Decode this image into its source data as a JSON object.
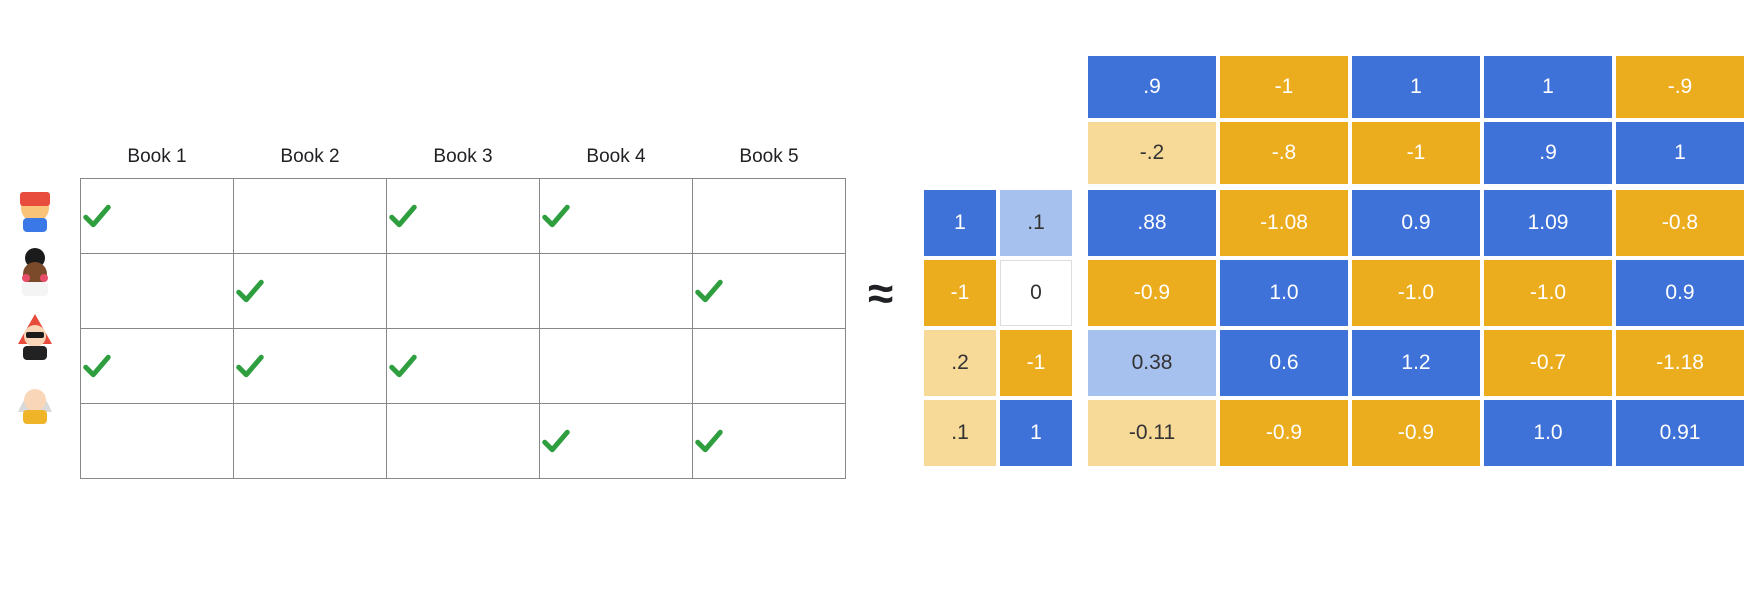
{
  "books": {
    "headers": [
      "Book 1",
      "Book 2",
      "Book 3",
      "Book 4",
      "Book 5"
    ],
    "checks": [
      [
        true,
        false,
        true,
        true,
        false
      ],
      [
        false,
        true,
        false,
        false,
        true
      ],
      [
        true,
        true,
        true,
        false,
        false
      ],
      [
        false,
        false,
        false,
        true,
        true
      ]
    ]
  },
  "approx_symbol": "≈",
  "chart_data": {
    "type": "table",
    "U": {
      "rows": 4,
      "cols": 2,
      "cells": [
        {
          "v": "1",
          "c": "blue"
        },
        {
          "v": ".1",
          "c": "blue-light"
        },
        {
          "v": "-1",
          "c": "gold"
        },
        {
          "v": "0",
          "c": "white"
        },
        {
          "v": ".2",
          "c": "gold-light"
        },
        {
          "v": "-1",
          "c": "gold"
        },
        {
          "v": ".1",
          "c": "gold-light"
        },
        {
          "v": "1",
          "c": "blue"
        }
      ]
    },
    "V": {
      "rows": 2,
      "cols": 5,
      "cells": [
        {
          "v": ".9",
          "c": "blue"
        },
        {
          "v": "-1",
          "c": "gold"
        },
        {
          "v": "1",
          "c": "blue"
        },
        {
          "v": "1",
          "c": "blue"
        },
        {
          "v": "-.9",
          "c": "gold"
        },
        {
          "v": "-.2",
          "c": "gold-light"
        },
        {
          "v": "-.8",
          "c": "gold"
        },
        {
          "v": "-1",
          "c": "gold"
        },
        {
          "v": ".9",
          "c": "blue"
        },
        {
          "v": "1",
          "c": "blue"
        }
      ]
    },
    "R": {
      "rows": 4,
      "cols": 5,
      "cells": [
        {
          "v": ".88",
          "c": "blue"
        },
        {
          "v": "-1.08",
          "c": "gold"
        },
        {
          "v": "0.9",
          "c": "blue"
        },
        {
          "v": "1.09",
          "c": "blue"
        },
        {
          "v": "-0.8",
          "c": "gold"
        },
        {
          "v": "-0.9",
          "c": "gold"
        },
        {
          "v": "1.0",
          "c": "blue"
        },
        {
          "v": "-1.0",
          "c": "gold"
        },
        {
          "v": "-1.0",
          "c": "gold"
        },
        {
          "v": "0.9",
          "c": "blue"
        },
        {
          "v": "0.38",
          "c": "blue-light"
        },
        {
          "v": "0.6",
          "c": "blue"
        },
        {
          "v": "1.2",
          "c": "blue"
        },
        {
          "v": "-0.7",
          "c": "gold"
        },
        {
          "v": "-1.18",
          "c": "gold"
        },
        {
          "v": "-0.11",
          "c": "gold-light"
        },
        {
          "v": "-0.9",
          "c": "gold"
        },
        {
          "v": "-0.9",
          "c": "gold"
        },
        {
          "v": "1.0",
          "c": "blue"
        },
        {
          "v": "0.91",
          "c": "blue"
        }
      ]
    }
  }
}
